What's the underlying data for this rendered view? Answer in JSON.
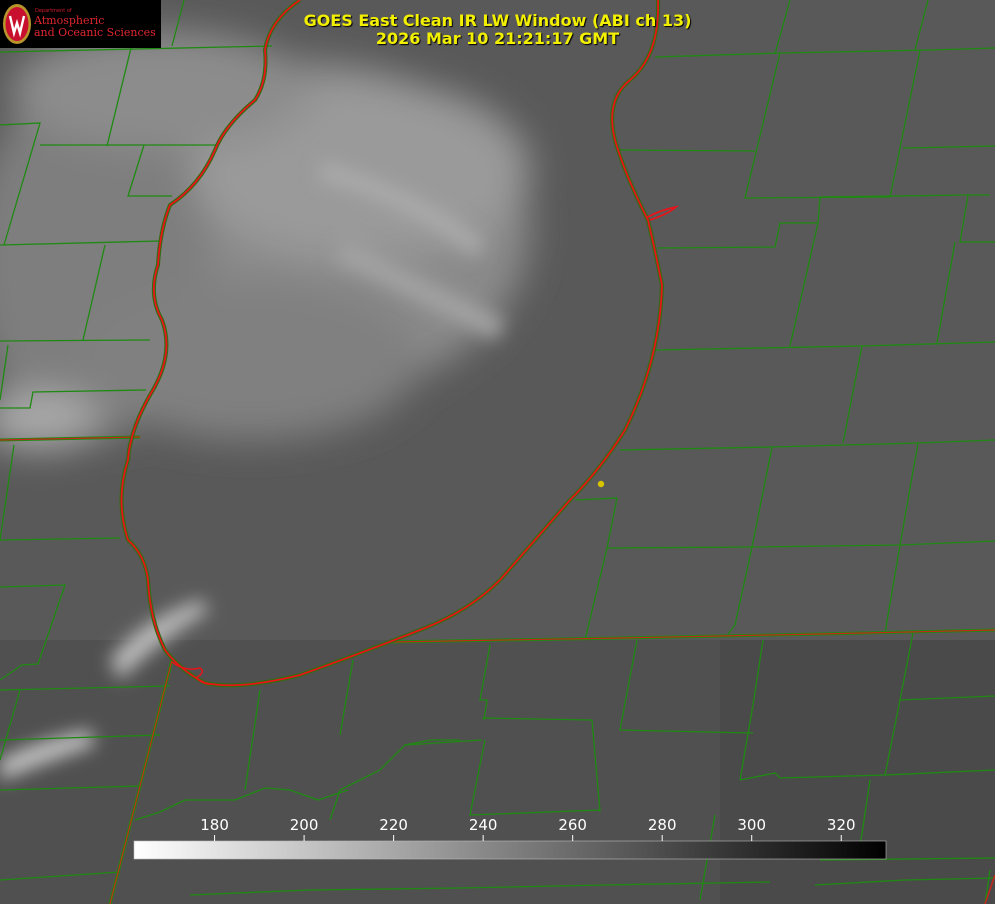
{
  "header": {
    "title_line1": "GOES East Clean IR LW Window (ABI ch 13)",
    "title_line2": "2026 Mar 10 21:21:17 GMT"
  },
  "logo": {
    "dept_small": "Department of",
    "line1": "Atmospheric",
    "line2": "and Oceanic Sciences"
  },
  "colorbar": {
    "ticks": [
      180,
      200,
      220,
      240,
      260,
      280,
      300,
      320
    ],
    "min": 162,
    "max": 330,
    "tick_color": "#ffffff",
    "gradient_start": "#ffffff",
    "gradient_end": "#000000"
  },
  "colors": {
    "title": "#f2f000",
    "coastline": "#e8141a",
    "county_lines": "#1f8a12",
    "marker": "#d7c300",
    "logo_text": "#e0262e"
  }
}
